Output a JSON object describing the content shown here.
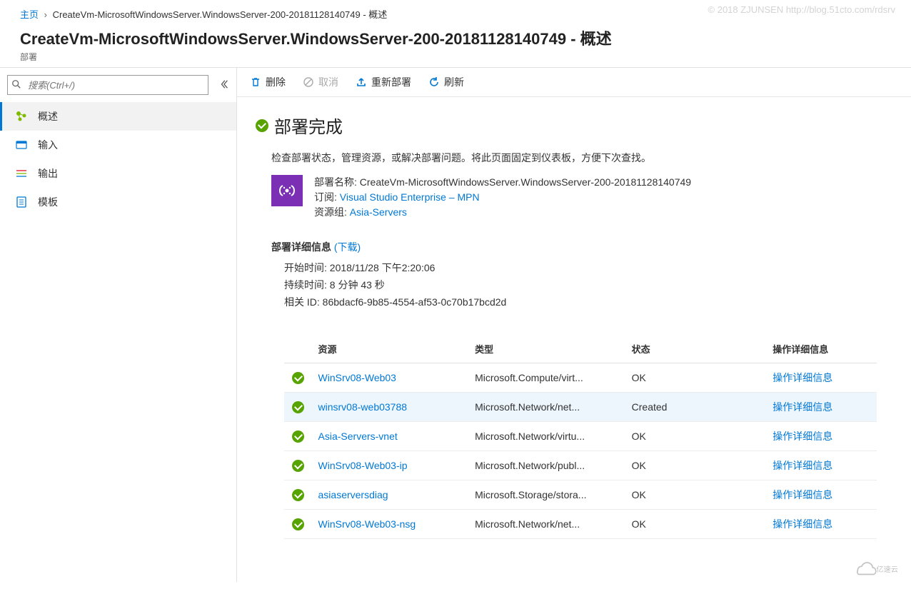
{
  "watermark": {
    "top": "© 2018 ZJUNSEN http://blog.51cto.com/rdsrv",
    "bottom": "亿速云"
  },
  "breadcrumb": {
    "home": "主页",
    "current": "CreateVm-MicrosoftWindowsServer.WindowsServer-200-20181128140749 - 概述"
  },
  "page": {
    "title": "CreateVm-MicrosoftWindowsServer.WindowsServer-200-20181128140749 - 概述",
    "subtitle": "部署"
  },
  "search": {
    "placeholder": "搜索(Ctrl+/)"
  },
  "sidebar": {
    "items": [
      {
        "label": "概述"
      },
      {
        "label": "输入"
      },
      {
        "label": "输出"
      },
      {
        "label": "模板"
      }
    ]
  },
  "toolbar": {
    "delete": "删除",
    "cancel": "取消",
    "redeploy": "重新部署",
    "refresh": "刷新"
  },
  "status": {
    "title": "部署完成"
  },
  "description": "检查部署状态，管理资源，或解决部署问题。将此页面固定到仪表板，方便下次查找。",
  "summary": {
    "deploy_name_label": "部署名称:",
    "deploy_name_value": "CreateVm-MicrosoftWindowsServer.WindowsServer-200-20181128140749",
    "subscription_label": "订阅:",
    "subscription_value": "Visual Studio Enterprise – MPN",
    "rg_label": "资源组:",
    "rg_value": "Asia-Servers"
  },
  "details": {
    "header_label": "部署详细信息",
    "download": "(下载)",
    "start_label": "开始时间:",
    "start_value": "2018/11/28 下午2:20:06",
    "duration_label": "持续时间:",
    "duration_value": "8 分钟 43 秒",
    "corr_label": "相关 ID:",
    "corr_value": "86bdacf6-9b85-4554-af53-0c70b17bcd2d"
  },
  "table": {
    "headers": {
      "resource": "资源",
      "type": "类型",
      "status": "状态",
      "op": "操作详细信息"
    },
    "op_detail": "操作详细信息",
    "rows": [
      {
        "name": "WinSrv08-Web03",
        "type": "Microsoft.Compute/virt...",
        "status": "OK",
        "highlight": false
      },
      {
        "name": "winsrv08-web03788",
        "type": "Microsoft.Network/net...",
        "status": "Created",
        "highlight": true
      },
      {
        "name": "Asia-Servers-vnet",
        "type": "Microsoft.Network/virtu...",
        "status": "OK",
        "highlight": false
      },
      {
        "name": "WinSrv08-Web03-ip",
        "type": "Microsoft.Network/publ...",
        "status": "OK",
        "highlight": false
      },
      {
        "name": "asiaserversdiag",
        "type": "Microsoft.Storage/stora...",
        "status": "OK",
        "highlight": false
      },
      {
        "name": "WinSrv08-Web03-nsg",
        "type": "Microsoft.Network/net...",
        "status": "OK",
        "highlight": false
      }
    ]
  }
}
